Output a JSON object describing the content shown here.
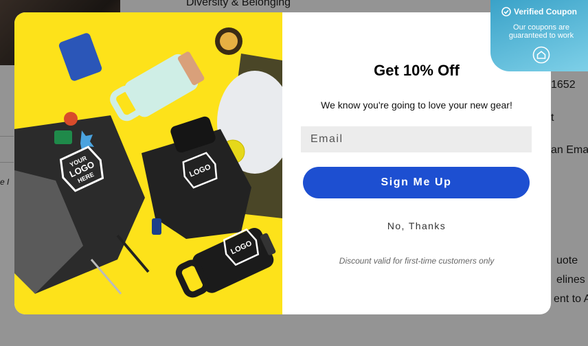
{
  "background": {
    "heading_text": "Diversity & Belonging",
    "snippets": [
      "1652",
      "t",
      "an Ema",
      "e I",
      "uote",
      "elines",
      "ent to A"
    ]
  },
  "modal": {
    "title": "Get 10% Off",
    "subtitle": "We know you're going to love your new gear!",
    "email_placeholder": "Email",
    "cta_label": "Sign Me Up",
    "decline_label": "No, Thanks",
    "disclaimer": "Discount valid for first-time customers only",
    "image_logo_text": [
      "YOUR",
      "LOGO",
      "HERE"
    ]
  },
  "badge": {
    "title": "Verified Coupon",
    "text": "Our coupons are guaranteed to work",
    "icon": "home-icon"
  },
  "colors": {
    "accent": "#1d4fd1",
    "image_bg": "#fde21a",
    "badge": "#3aa2c8"
  }
}
